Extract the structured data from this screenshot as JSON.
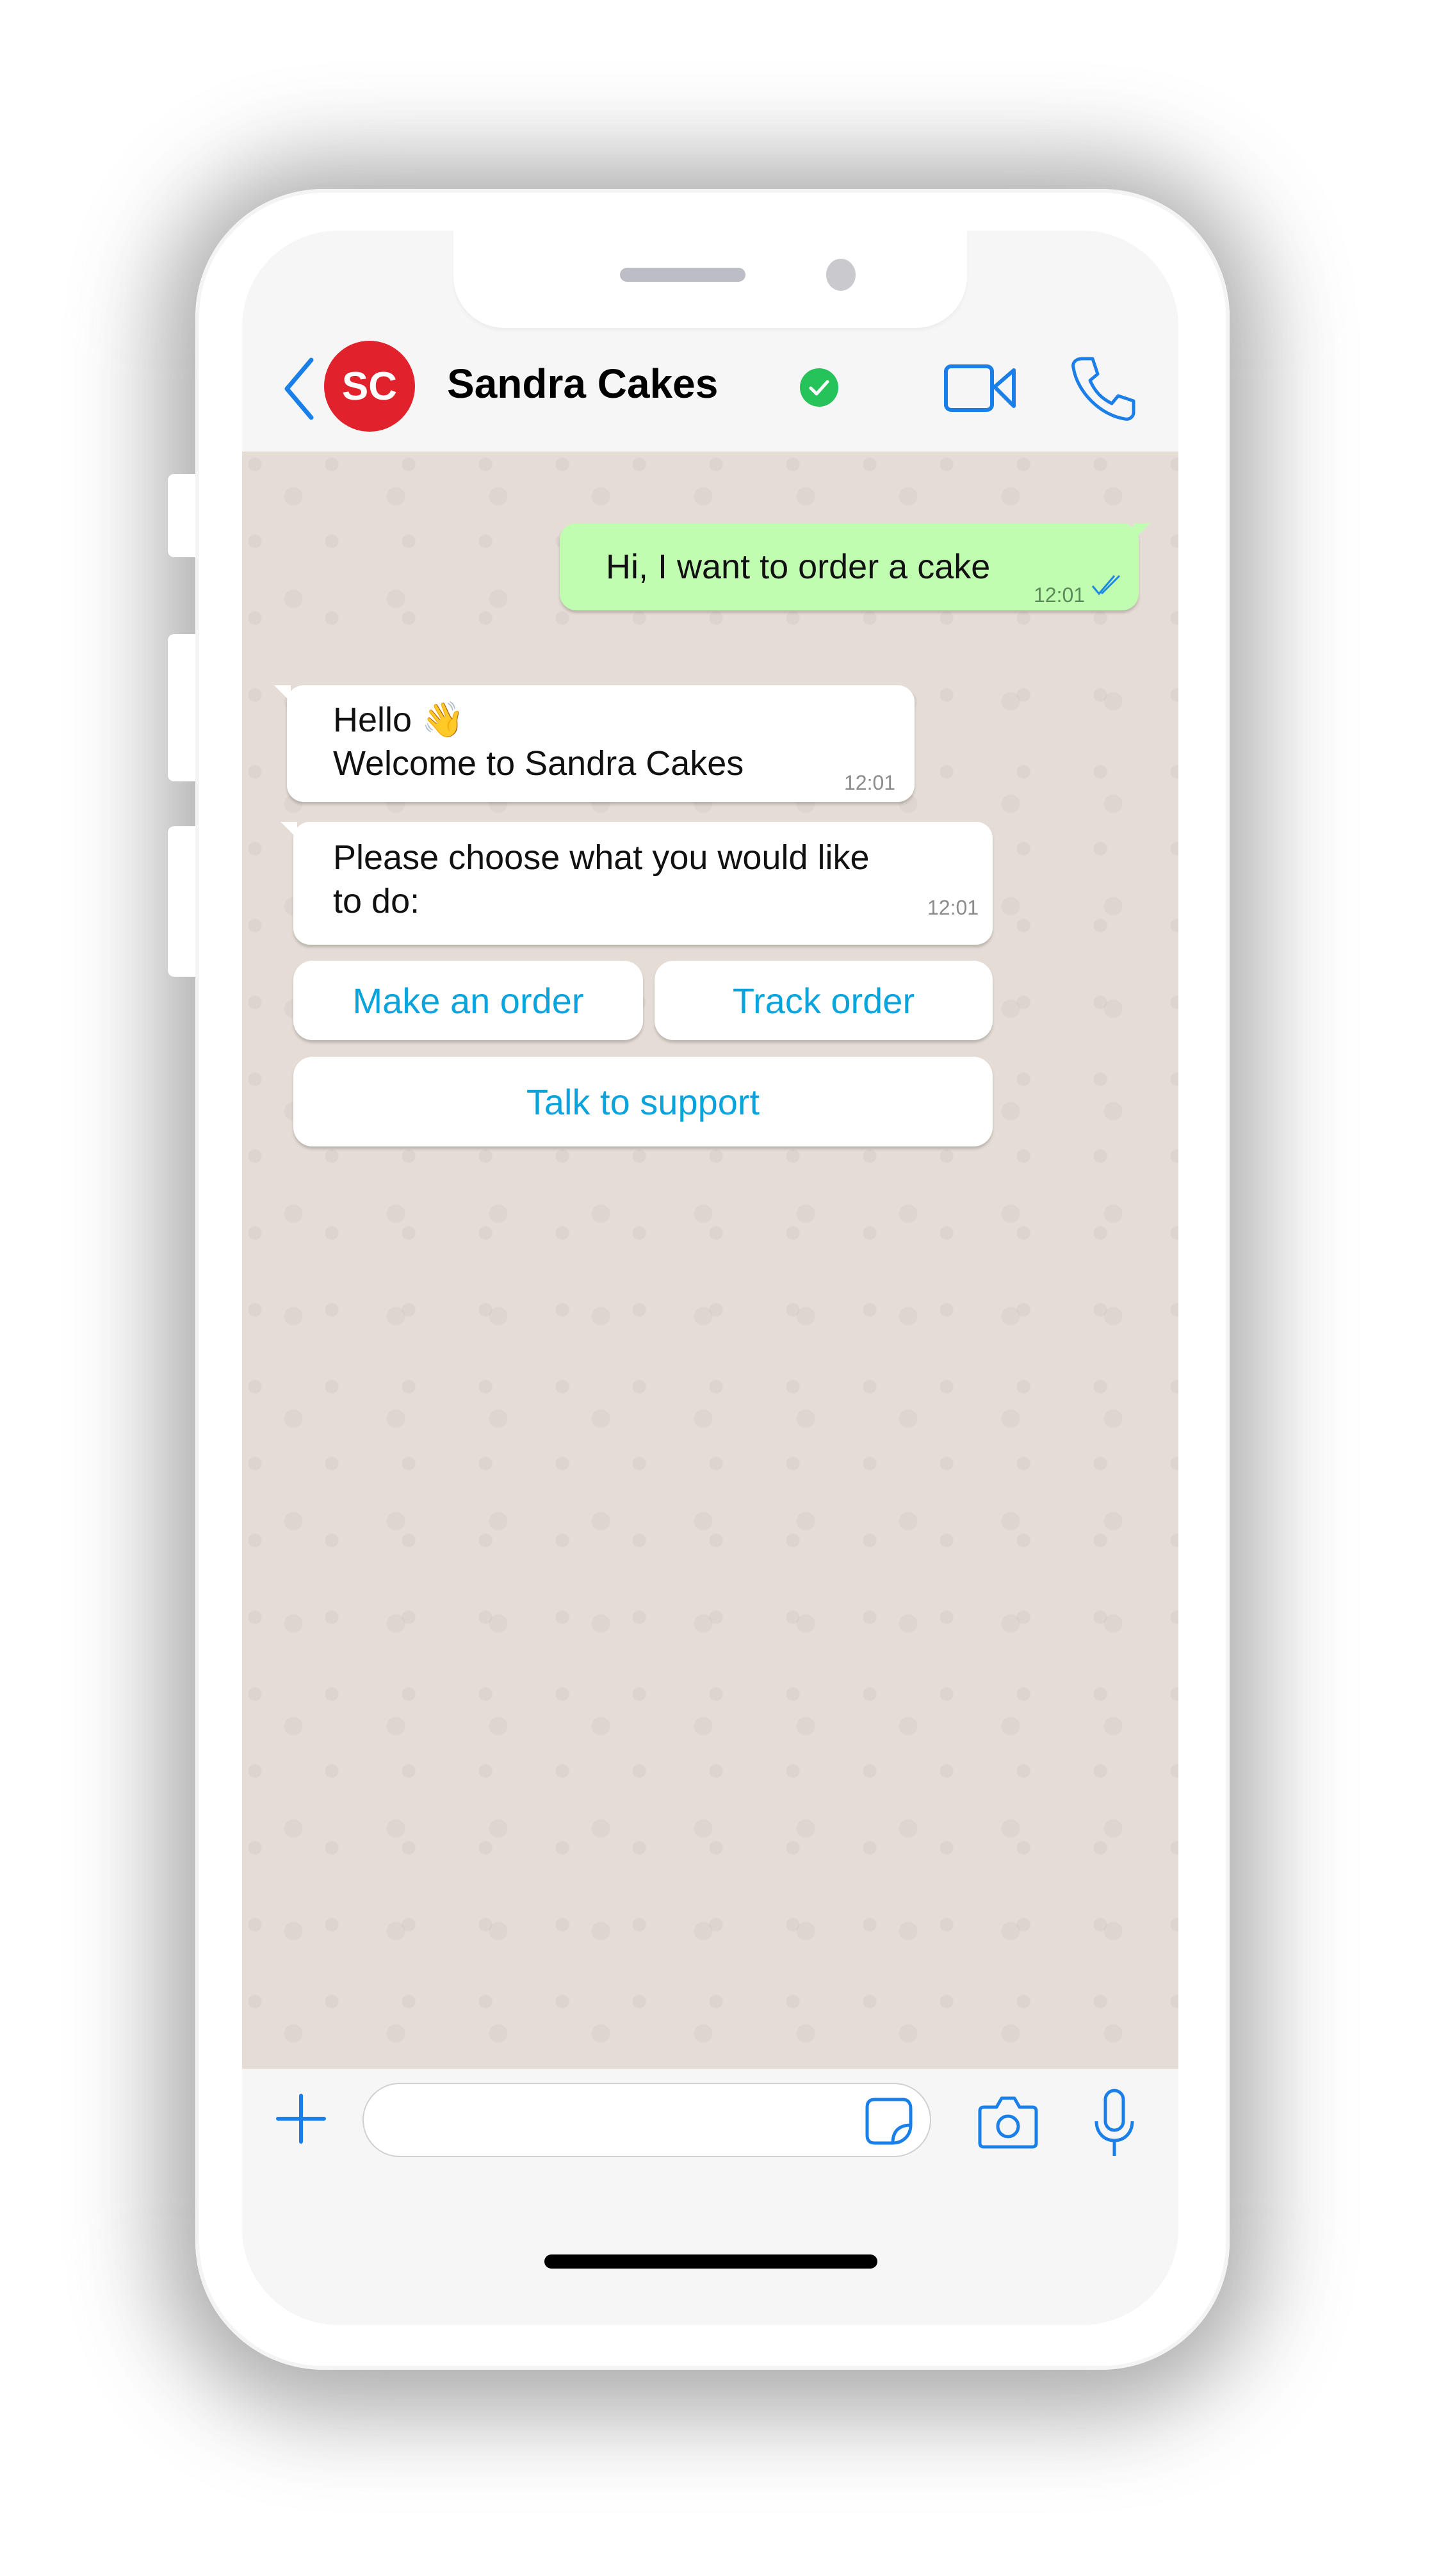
{
  "header": {
    "contact_name": "Sandra Cakes",
    "avatar_initials": "SC",
    "verified": true,
    "icons": [
      "back-chevron-icon",
      "verified-badge-icon",
      "video-call-icon",
      "phone-call-icon"
    ]
  },
  "colors": {
    "accent": "#1a7fe8",
    "avatar_bg": "#e1212c",
    "verified": "#25c35a",
    "outgoing_bubble": "#c0fdb0",
    "incoming_bubble": "#ffffff",
    "chat_background": "#e5ddd5",
    "quick_reply_text": "#0aa4dc",
    "read_ticks": "#1e88e5"
  },
  "messages": [
    {
      "direction": "outgoing",
      "text": "Hi, I want to order a cake",
      "time": "12:01",
      "status": "read"
    },
    {
      "direction": "incoming",
      "lines": [
        "Hello 👋",
        "Welcome to Sandra Cakes"
      ],
      "time": "12:01"
    },
    {
      "direction": "incoming",
      "lines": [
        "Please choose what you would like",
        "to do:"
      ],
      "time": "12:01"
    }
  ],
  "quick_replies": [
    {
      "label": "Make an order"
    },
    {
      "label": "Track order"
    },
    {
      "label": "Talk to support"
    }
  ],
  "composer": {
    "value": "",
    "placeholder": "",
    "icons": [
      "plus-icon",
      "sticker-icon",
      "camera-icon",
      "microphone-icon"
    ]
  }
}
